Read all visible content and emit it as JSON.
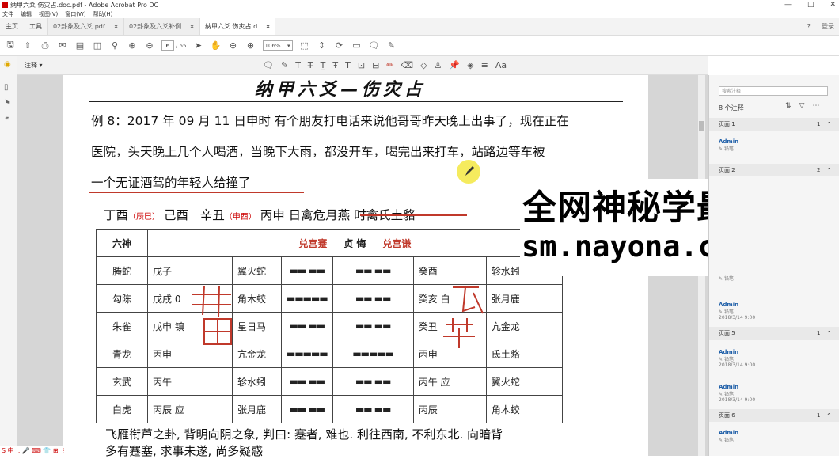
{
  "window": {
    "title": "纳甲六爻 伤灾占.doc.pdf - Adobe Acrobat Pro DC",
    "controls": [
      "—",
      "□",
      "✕"
    ]
  },
  "menu": [
    "文件",
    "编辑",
    "视图(V)",
    "窗口(W)",
    "帮助(H)"
  ],
  "tabs": {
    "home": "主页",
    "tools": "工具",
    "docs": [
      {
        "label": "02卦象及六爻.pdf",
        "active": false
      },
      {
        "label": "02卦象及六爻补例...",
        "active": false
      },
      {
        "label": "纳甲六爻 伤灾占.d...",
        "active": true
      }
    ],
    "help_icon": "?",
    "login": "登录"
  },
  "toolbar": {
    "page_current": "6",
    "page_total": "/ 55",
    "zoom": "106%"
  },
  "annotation_bar": {
    "label": "注释 ▾"
  },
  "document": {
    "title": "纳甲六爻—伤灾占",
    "para1": "例 8：2017 年 09 月 11 日申时  有个朋友打电话来说他哥哥昨天晚上出事了，现在正在",
    "para2": "医院，头天晚上几个人喝酒，当晚下大雨，都没开车，喝完出来打车，站路边等车被",
    "para3": "一个无证酒驾的年轻人给撞了",
    "ganzhi": {
      "g1": "丁酉",
      "k1": "（辰巳）",
      "g2": "己酉",
      "g3": "辛丑",
      "k2": "（申酉）",
      "g4": "丙申",
      "rest": "日禽危月燕  时禽氏土貉"
    },
    "table": {
      "head_col": "六神",
      "head_title_left": "兑宫蹇",
      "head_title_mid": "贞     悔",
      "head_title_right": "兑宫谦",
      "rows": [
        {
          "shen": "螣蛇",
          "a": "戊子",
          "b": "翼火蛇",
          "y1": "▬▬ ▬▬",
          "y2": "▬▬ ▬▬",
          "c": "癸酉",
          "d": "轸水蚓"
        },
        {
          "shen": "勾陈",
          "a": "戊戌 0",
          "b": "角木蛟",
          "y1": "▬▬▬▬▬",
          "y2": "▬▬ ▬▬",
          "c": "癸亥   白",
          "d": "张月鹿"
        },
        {
          "shen": "朱雀",
          "a": "戊申  镇",
          "b": "星日马",
          "y1": "▬▬ ▬▬",
          "y2": "▬▬ ▬▬",
          "c": "癸丑",
          "d": "亢金龙"
        },
        {
          "shen": "青龙",
          "a": "丙申",
          "b": "亢金龙",
          "y1": "▬▬▬▬▬",
          "y2": "▬▬▬▬▬",
          "c": "丙申",
          "d": "氐土貉"
        },
        {
          "shen": "玄武",
          "a": "丙午",
          "b": "轸水蚓",
          "y1": "▬▬ ▬▬",
          "y2": "▬▬ ▬▬",
          "c": "丙午   应",
          "d": "翼火蛇"
        },
        {
          "shen": "白虎",
          "a": "丙辰  应",
          "b": "张月鹿",
          "y1": "▬▬ ▬▬",
          "y2": "▬▬ ▬▬",
          "c": "丙辰",
          "d": "角木蛟"
        }
      ]
    },
    "bottom1": "飞雁衔芦之卦,  背明向阴之象,  判曰:  蹇者,  难也.  利往西南,  不利东北.  向暗背",
    "bottom2": "多有蹇塞,  求事未遂,  尚多疑惑"
  },
  "overlay": {
    "line1": "全网神秘学最全",
    "line2": "sm.nayona.cn"
  },
  "comments_panel": {
    "search_placeholder": "搜索注释",
    "count": "8 个注释",
    "pages": [
      {
        "label": "页面 1",
        "n": "1"
      },
      {
        "label": "页面 2",
        "n": "2"
      },
      {
        "label": "页面 5",
        "n": "1"
      },
      {
        "label": "页面 6",
        "n": "1"
      }
    ],
    "items": [
      {
        "author": "Admin",
        "kind": "铅笔"
      },
      {
        "author": "Admin",
        "kind": "铅笔"
      },
      {
        "author": "Admin",
        "kind": "铅笔"
      },
      {
        "author": "Admin",
        "kind": "铅笔"
      },
      {
        "author": "Admin",
        "kind": "铅笔"
      },
      {
        "author": "Admin",
        "kind": "铅笔"
      }
    ],
    "date": "2018/3/14 9:00"
  },
  "taskbar": "S 中 ·, 🎤 ⌨ 👕 ⊞ ⋮"
}
